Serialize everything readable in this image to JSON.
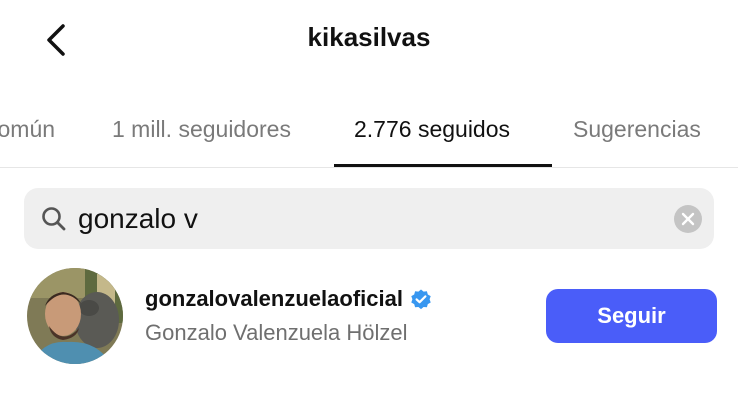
{
  "header": {
    "title": "kikasilvas",
    "back_icon": "chevron-left-icon"
  },
  "tabs": [
    {
      "label": "común",
      "active": false
    },
    {
      "label": "1 mill. seguidores",
      "active": false
    },
    {
      "label": "2.776 seguidos",
      "active": true
    },
    {
      "label": "Sugerencias",
      "active": false
    }
  ],
  "search": {
    "value": "gonzalo v",
    "icon": "search-icon",
    "clear_icon": "clear-icon"
  },
  "results": [
    {
      "username": "gonzalovalenzuelaoficial",
      "verified": true,
      "full_name": "Gonzalo Valenzuela Hölzel",
      "follow_label": "Seguir"
    }
  ],
  "colors": {
    "accent": "#4a5df9",
    "verified": "#3897f0",
    "muted_text": "#7a7a7a"
  }
}
